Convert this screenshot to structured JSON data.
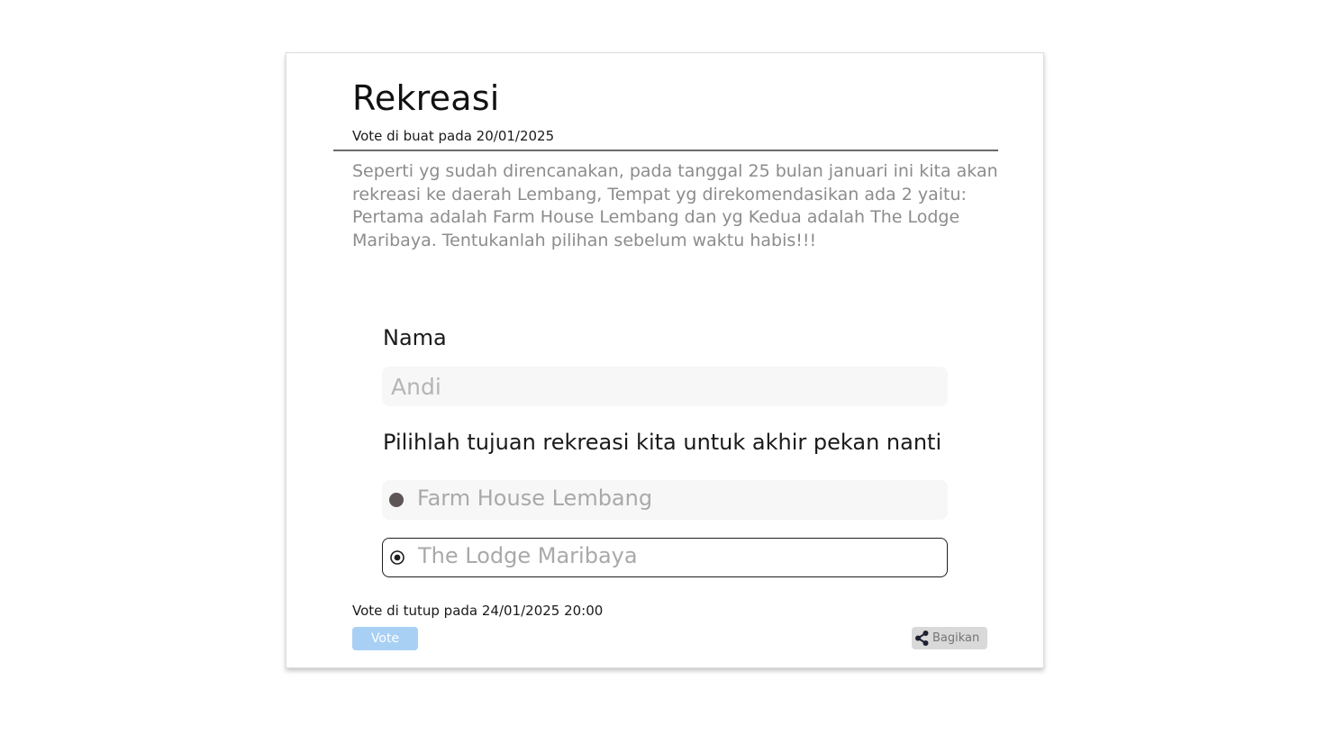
{
  "poll": {
    "title": "Rekreasi",
    "created_text": "Vote di buat pada 20/01/2025",
    "description": "Seperti yg sudah direncanakan, pada tanggal 25 bulan januari ini kita akan rekreasi ke daerah Lembang, Tempat yg direkomendasikan ada 2 yaitu:\nPertama adalah Farm House Lembang dan yg Kedua adalah The Lodge Maribaya. Tentukanlah pilihan sebelum waktu habis!!!"
  },
  "form": {
    "name_label": "Nama",
    "name_placeholder": "Andi",
    "question": "Pilihlah tujuan rekreasi kita untuk akhir pekan nanti",
    "options": [
      {
        "label": "Farm House Lembang",
        "state": "filled-dot"
      },
      {
        "label": "The Lodge Maribaya",
        "state": "selected-ring"
      }
    ]
  },
  "footer": {
    "closed_text": "Vote di tutup pada 24/01/2025 20:00",
    "vote_label": "Vote",
    "share_label": "Bagikan",
    "share_icon": "share-icon"
  },
  "colors": {
    "vote_button": "#a8d0f5",
    "share_button": "#d9d9d9",
    "description_text": "#8c8c8c",
    "radio_dot": "#5e5656"
  }
}
